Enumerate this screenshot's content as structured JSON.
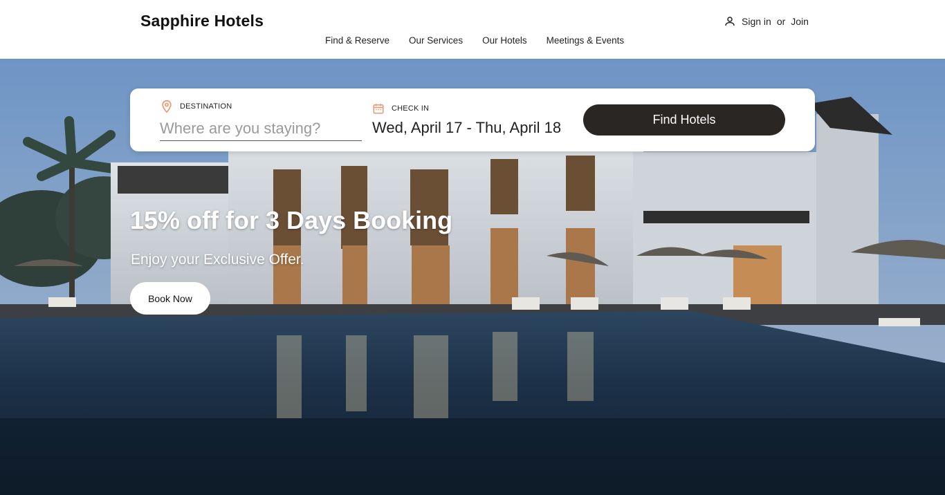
{
  "brand": "Sapphire Hotels",
  "nav": {
    "items": [
      "Find & Reserve",
      "Our Services",
      "Our Hotels",
      "Meetings & Events"
    ]
  },
  "auth": {
    "sign_in": "Sign in",
    "or": "or",
    "join": "Join",
    "icon": "user-icon"
  },
  "search": {
    "destination_label": "DESTINATION",
    "destination_placeholder": "Where are you staying?",
    "destination_value": "",
    "checkin_label": "CHECK IN",
    "dates": "Wed, April 17 - Thu, April 18",
    "find_button": "Find Hotels",
    "accent_color": "#f0956c"
  },
  "promo": {
    "title": "15% off for 3 Days Booking",
    "subtitle": "Enjoy your Exclusive Offer.",
    "cta": "Book Now"
  },
  "colors": {
    "button_dark": "#2a2624"
  }
}
